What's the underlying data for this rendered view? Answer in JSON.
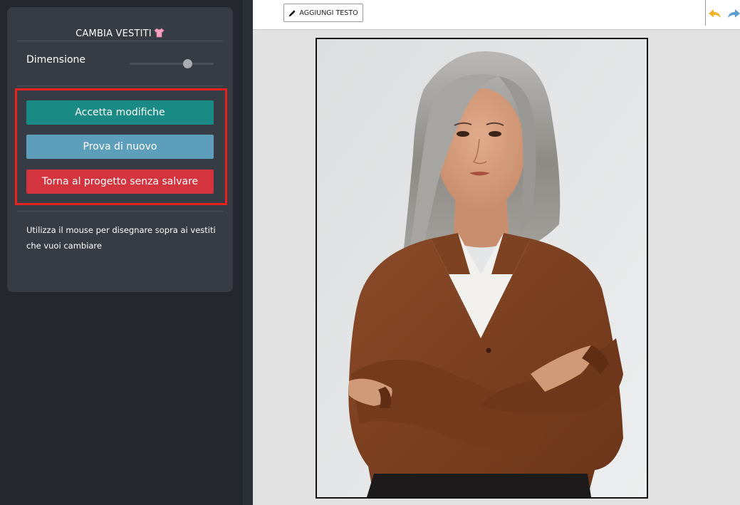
{
  "sidebar": {
    "panel": {
      "title": "CAMBIA VESTITI",
      "title_icon": "shirt-icon",
      "size_label": "Dimensione",
      "size_value_fraction": 0.69,
      "buttons": {
        "accept": "Accetta modifiche",
        "retry": "Prova di nuovo",
        "back": "Torna al progetto senza salvare"
      },
      "hint": "Utilizza il mouse per disegnare sopra ai vestiti che vuoi cambiare"
    },
    "collapse_icon": "chevron-left-icon"
  },
  "toolbar": {
    "add_text_label": "AGGIUNGI TESTO",
    "add_text_icon": "pencil-icon",
    "undo_icon": "undo-icon",
    "redo_icon": "redo-icon"
  },
  "canvas": {
    "image_subject": "woman-portrait-photo"
  },
  "colors": {
    "sidebar_bg": "#24282e",
    "panel_bg": "#373c44",
    "accept": "#1a8a85",
    "retry": "#5d9fbb",
    "back": "#d3343d",
    "highlight": "#e8221f",
    "undo": "#f0b429",
    "redo": "#5b9ed1"
  }
}
